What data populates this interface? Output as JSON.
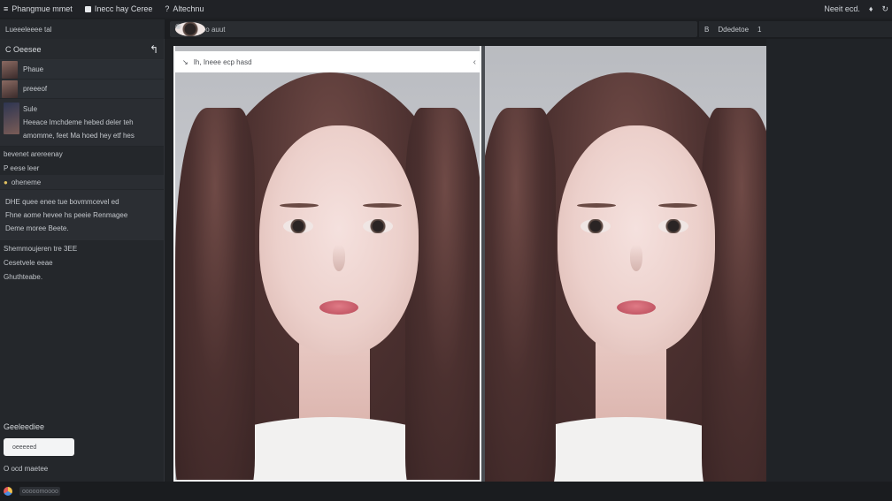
{
  "menubar": {
    "app_label": "Phangmue mmet",
    "item1": "Inecc hay Ceree",
    "item2": "Altechnu",
    "right_label": "Neeit ecd.",
    "right_icon1": "bell-icon",
    "right_icon2": "refresh-icon"
  },
  "toolbar": {
    "left_title": "Lueeeleeee tal",
    "address": "Coeeeo auut",
    "panel_label": "Ddedetoe",
    "panel_count": "1"
  },
  "sidebar": {
    "header": "C Oeesee",
    "items": [
      {
        "label": "Phaue"
      },
      {
        "label": "preeeof"
      }
    ],
    "block1": [
      "Sule",
      "Heeace lmchdeme hebed deler teh",
      "amomme, feet Ma hoed hey etf hes",
      "bevenet arereenay",
      "P eese leer"
    ],
    "section_title": "oheneme",
    "block2": [
      "DHE quee enee tue bovmmcevel ed",
      "Fhne aome hevee hs peeie Renmagee",
      "Deme moree Beete.",
      "Shemmoujeren tre 3EE",
      "Cesetvele eeae",
      "Ghuthteabe."
    ],
    "bottom_label": "Geeleediee",
    "bottom_button": "oeeeeed",
    "footer": "O ocd maetee"
  },
  "dialog": {
    "title": "Ih, Ineee ecp hasd"
  },
  "statusbar": {
    "text": "ooooomoooo"
  },
  "colors": {
    "background": "#1e2023",
    "sidebar": "#24272b",
    "accent": "#f4f5f6"
  }
}
